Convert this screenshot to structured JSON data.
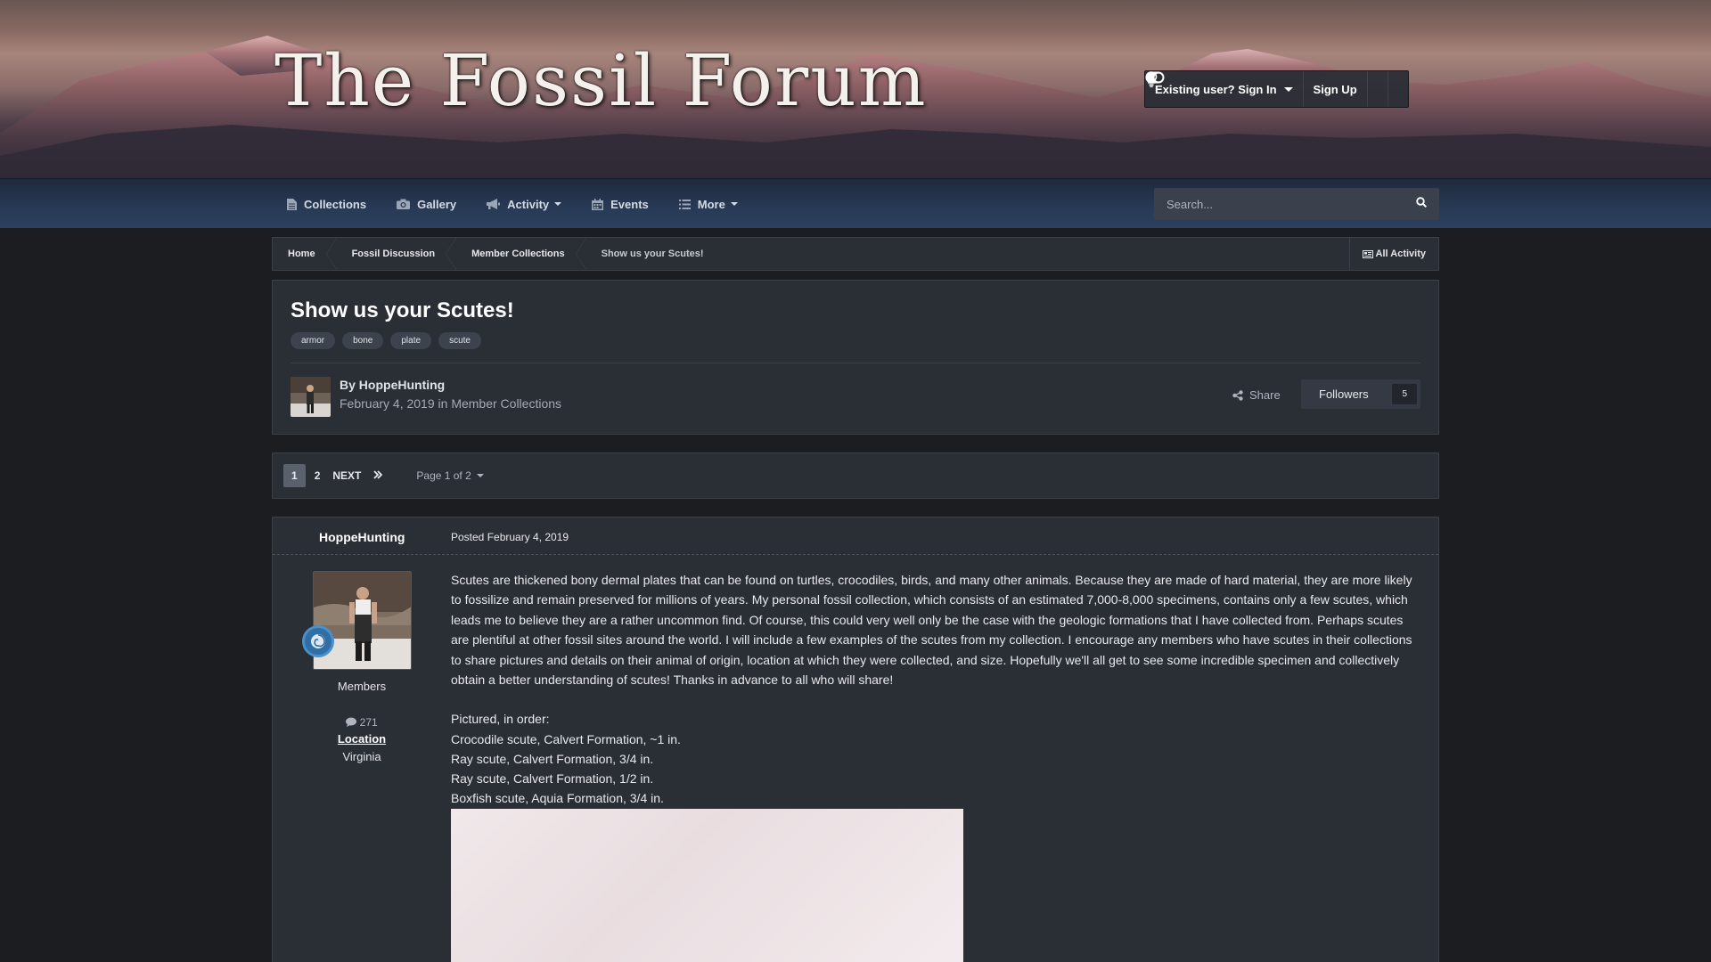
{
  "header": {
    "logo_text": "The Fossil Forum",
    "signin_label": "Existing user? Sign In",
    "signup_label": "Sign Up"
  },
  "nav": {
    "items": [
      {
        "label": "Collections",
        "icon": "file-icon"
      },
      {
        "label": "Gallery",
        "icon": "camera-icon"
      },
      {
        "label": "Activity",
        "icon": "megaphone-icon"
      },
      {
        "label": "Events",
        "icon": "calendar-icon"
      },
      {
        "label": "More",
        "icon": "list-icon"
      }
    ],
    "search_placeholder": "Search..."
  },
  "breadcrumb": {
    "items": [
      "Home",
      "Fossil Discussion",
      "Member Collections",
      "Show us your Scutes!"
    ],
    "all_activity": "All Activity"
  },
  "topic": {
    "title": "Show us your Scutes!",
    "tags": [
      "armor",
      "bone",
      "plate",
      "scute"
    ],
    "by_prefix": "By",
    "author": "HoppeHunting",
    "date": "February 4, 2019",
    "in_word": "in",
    "forum": "Member Collections",
    "share_label": "Share",
    "followers_label": "Followers",
    "followers_count": "5"
  },
  "pagination": {
    "pages": [
      "1",
      "2"
    ],
    "current": "1",
    "next_label": "NEXT",
    "page_info": "Page 1 of 2"
  },
  "post": {
    "author": "HoppeHunting",
    "posted": "Posted February 4, 2019",
    "group": "Members",
    "post_count": "271",
    "location_label": "Location",
    "location_value": "Virginia",
    "paragraph": "Scutes are thickened bony dermal plates that can be found on turtles, crocodiles, birds, and many other animals. Because they are made of hard material, they are more likely to fossilize and remain preserved for millions of years. My personal fossil collection, which consists of an estimated 7,000-8,000 specimens, contains only a few scutes, which leads me to believe they are a rather uncommon find. Of course, this could very well only be the case with the geologic formations that I have collected from. Perhaps scutes are plentiful at other fossil sites around the world. I will include a few examples of the scutes from my collection. I encourage any members who have scutes in their collections to share pictures and details on their animal of origin, location at which they were collected, and size. Hopefully we'll all get to see some incredible specimen and collectively obtain a better understanding of scutes! Thanks in advance to all who will share!",
    "list_lines": [
      "Pictured, in order:",
      "Crocodile scute, Calvert Formation, ~1 in.",
      "Ray scute, Calvert Formation, 3/4 in.",
      "Ray scute, Calvert Formation, 1/2 in.",
      "Boxfish scute, Aquia Formation, 3/4 in."
    ]
  }
}
